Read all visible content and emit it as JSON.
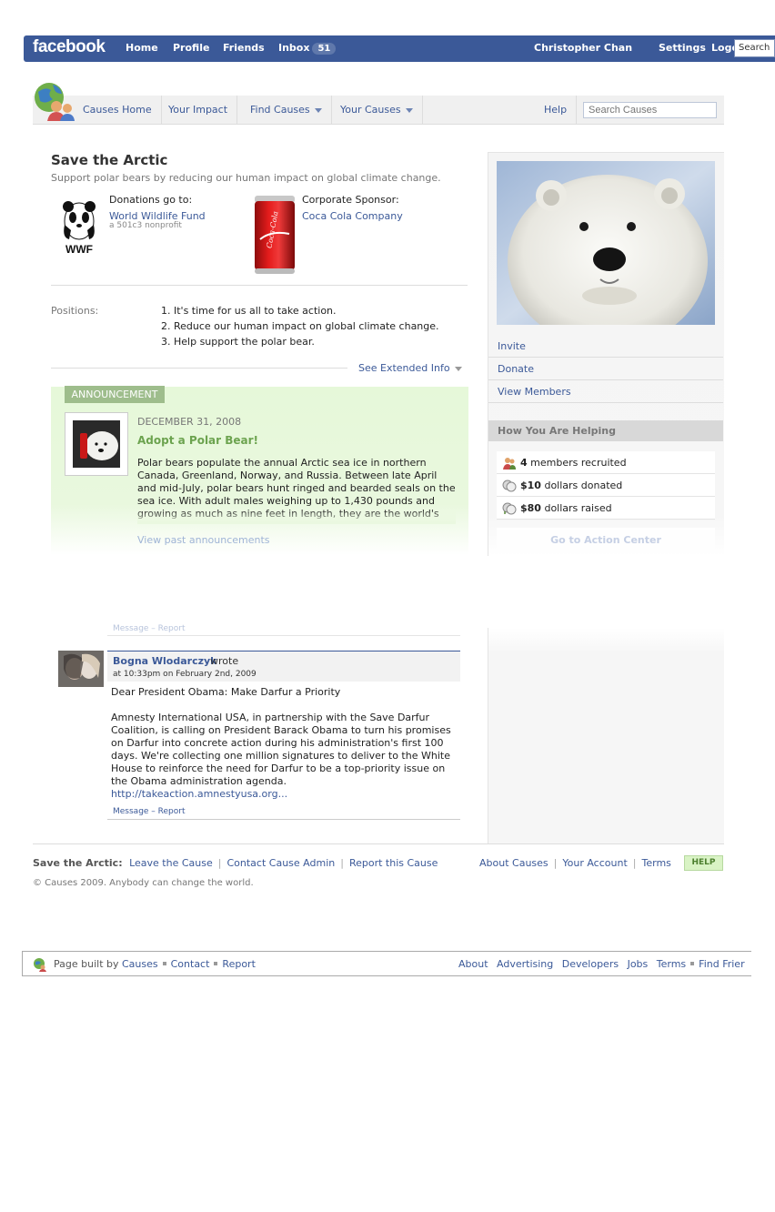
{
  "fb_bar": {
    "logo": "facebook",
    "nav": [
      "Home",
      "Profile",
      "Friends",
      "Inbox"
    ],
    "inbox_count": "51",
    "user_name": "Christopher Chan",
    "settings": "Settings",
    "logout": "Logout",
    "search_value": "Search"
  },
  "causes_nav": {
    "tabs": [
      "Causes Home",
      "Your Impact",
      "Find Causes",
      "Your Causes"
    ],
    "help": "Help",
    "search_placeholder": "Search Causes"
  },
  "cause": {
    "title": "Save the Arctic",
    "subtitle": "Support polar bears by reducing our human impact on global climate change.",
    "donations_label": "Donations go to:",
    "donations_org": "World Wildlife Fund",
    "donations_note": "a 501c3 nonprofit",
    "sponsor_label": "Corporate Sponsor:",
    "sponsor_name": "Coca Cola Company",
    "positions_label": "Positions:",
    "positions": [
      "1. It's time for us all to take action.",
      "2. Reduce our human impact on global climate change.",
      "3. Help support the polar bear."
    ],
    "extended_info": "See Extended Info"
  },
  "announcement": {
    "label": "ANNOUNCEMENT",
    "date": "DECEMBER 31, 2008",
    "title": "Adopt a Polar Bear!",
    "body": "Polar bears populate the annual Arctic sea ice in northern Canada, Greenland, Norway, and Russia. Between late April and mid-July, polar bears hunt ringed and bearded seals on the sea ice. With adult males weighing up to 1,430 pounds and growing as much as nine feet in length, they are the world's largest...",
    "past_link": "View past announcements"
  },
  "sidebar": {
    "links": [
      "Invite",
      "Donate",
      "View Members"
    ],
    "helping_header": "How You Are Helping",
    "helping": [
      {
        "bold": "4",
        "text": " members recruited",
        "icon": "members-icon"
      },
      {
        "bold": "$10",
        "text": " dollars donated",
        "icon": "coins-icon"
      },
      {
        "bold": "$80",
        "text": " dollars raised",
        "icon": "coins-raised-icon"
      }
    ],
    "action_center": "Go to Action Center"
  },
  "wall": {
    "prev_actions": "Message – Report",
    "author": "Bogna Wlodarczyk",
    "wrote": "wrote",
    "time": "at 10:33pm on February 2nd, 2009",
    "subject": "Dear President Obama: Make Darfur a Priority",
    "body": "Amnesty International USA, in partnership with the Save Darfur Coalition, is calling on President Barack Obama to turn his promises on Darfur into concrete action during his administration's first 100 days. We're collecting one million signatures to deliver to the White House to reinforce the need for Darfur to be a top-priority issue on the Obama administration agenda.",
    "link": "http://takeaction.amnestyusa.org...",
    "actions": "Message – Report"
  },
  "footer": {
    "cause_prefix": "Save the Arctic:",
    "left_links": [
      "Leave the Cause",
      "Contact Cause Admin",
      "Report this Cause"
    ],
    "right_links": [
      "About Causes",
      "Your Account",
      "Terms"
    ],
    "help_badge": "HELP",
    "copyright": "© Causes 2009. Anybody can change the world."
  },
  "fb_footer": {
    "built_by": "Page built by",
    "app_links": [
      "Causes",
      "Contact",
      "Report"
    ],
    "right_links": [
      "About",
      "Advertising",
      "Developers",
      "Jobs",
      "Terms",
      "Find Frier"
    ]
  }
}
